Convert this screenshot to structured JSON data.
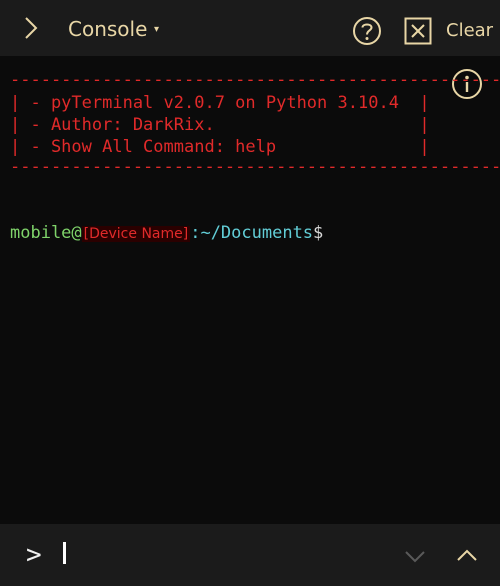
{
  "toolbar": {
    "title": "Console",
    "caret": "▾",
    "clear_label": "Clear"
  },
  "console": {
    "banner": {
      "rule": "------------------------------------------------",
      "lines": [
        "| - pyTerminal v2.0.7 on Python 3.10.4  |",
        "| - Author: DarkRix.                    |",
        "| - Show All Command: help              |"
      ]
    },
    "prompt": {
      "user": "mobile@",
      "device": "[Device Name]",
      "path": ":~/Documents",
      "symbol": "$"
    }
  },
  "input": {
    "prompt_symbol": ">"
  },
  "colors": {
    "accent": "#e8d6a6",
    "error_red": "#e12a2a",
    "user_green": "#7fd36a",
    "path_cyan": "#62cdd6"
  }
}
